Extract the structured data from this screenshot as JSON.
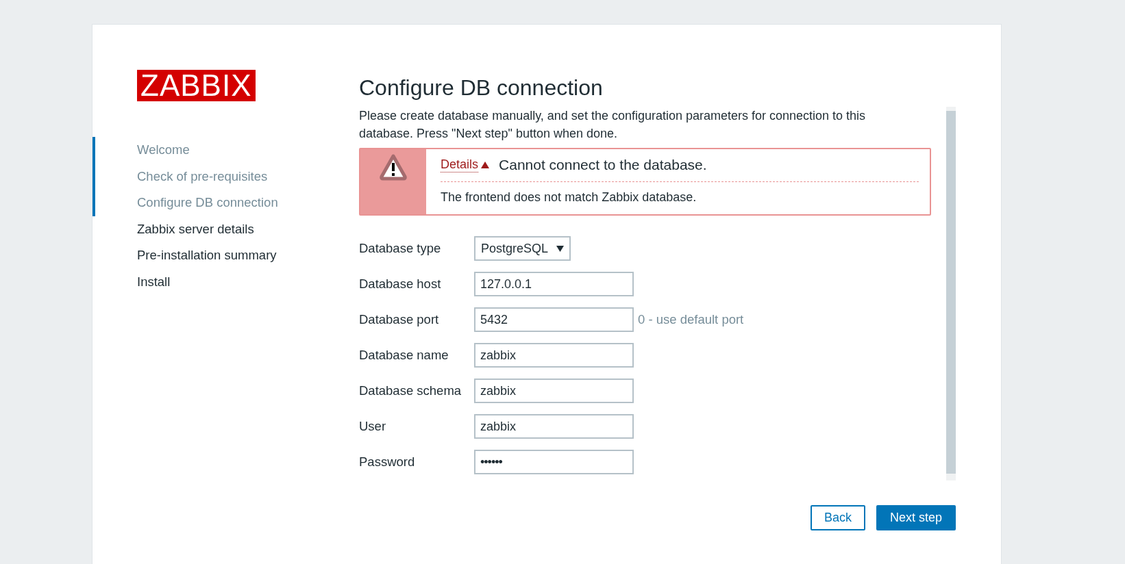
{
  "logo": "ZABBIX",
  "steps": [
    {
      "label": "Welcome",
      "passed": true
    },
    {
      "label": "Check of pre-requisites",
      "passed": true
    },
    {
      "label": "Configure DB connection",
      "passed": true
    },
    {
      "label": "Zabbix server details",
      "passed": false
    },
    {
      "label": "Pre-installation summary",
      "passed": false
    },
    {
      "label": "Install",
      "passed": false
    }
  ],
  "title": "Configure DB connection",
  "intro": "Please create database manually, and set the configuration parameters for connection to this database. Press \"Next step\" button when done.",
  "message": {
    "kind": "error",
    "details_label": "Details",
    "details_expanded": true,
    "title": "Cannot connect to the database.",
    "details": [
      "The frontend does not match Zabbix database."
    ]
  },
  "fields": [
    {
      "kind": "select",
      "label": "Database type",
      "value": "PostgreSQL"
    },
    {
      "kind": "text",
      "label": "Database host",
      "value": "127.0.0.1"
    },
    {
      "kind": "text",
      "label": "Database port",
      "value": "5432",
      "hint": "0 - use default port"
    },
    {
      "kind": "text",
      "label": "Database name",
      "value": "zabbix"
    },
    {
      "kind": "text",
      "label": "Database schema",
      "value": "zabbix"
    },
    {
      "kind": "text",
      "label": "User",
      "value": "zabbix"
    },
    {
      "kind": "password",
      "label": "Password",
      "value": "••••••"
    }
  ],
  "buttons": [
    {
      "label": "Back",
      "kind": "secondary"
    },
    {
      "label": "Next step",
      "kind": "primary"
    }
  ]
}
